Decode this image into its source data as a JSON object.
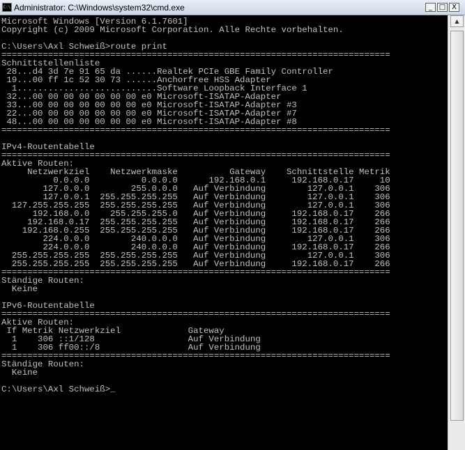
{
  "window": {
    "icon_text": "C:\\",
    "title": "Administrator: C:\\Windows\\system32\\cmd.exe",
    "minimize_glyph": "_",
    "maximize_glyph": "□",
    "close_glyph": "X"
  },
  "console": {
    "text": "Microsoft Windows [Version 6.1.7601]\nCopyright (c) 2009 Microsoft Corporation. Alle Rechte vorbehalten.\n\nC:\\Users\\Axl Schweiß>route print\n===========================================================================\nSchnittstellenliste\n 28...d4 3d 7e 91 65 da ......Realtek PCIe GBE Family Controller\n 19...00 ff 1c 52 30 73 ......Anchorfree HSS Adapter\n  1...........................Software Loopback Interface 1\n 32...00 00 00 00 00 00 00 e0 Microsoft-ISATAP-Adapter\n 33...00 00 00 00 00 00 00 e0 Microsoft-ISATAP-Adapter #3\n 22...00 00 00 00 00 00 00 e0 Microsoft-ISATAP-Adapter #7\n 48...00 00 00 00 00 00 00 e0 Microsoft-ISATAP-Adapter #8\n===========================================================================\n\nIPv4-Routentabelle\n===========================================================================\nAktive Routen:\n     Netzwerkziel    Netzwerkmaske          Gateway    Schnittstelle Metrik\n          0.0.0.0          0.0.0.0      192.168.0.1     192.168.0.17     10\n        127.0.0.0        255.0.0.0   Auf Verbindung        127.0.0.1    306\n        127.0.0.1  255.255.255.255   Auf Verbindung        127.0.0.1    306\n  127.255.255.255  255.255.255.255   Auf Verbindung        127.0.0.1    306\n      192.168.0.0    255.255.255.0   Auf Verbindung     192.168.0.17    266\n     192.168.0.17  255.255.255.255   Auf Verbindung     192.168.0.17    266\n    192.168.0.255  255.255.255.255   Auf Verbindung     192.168.0.17    266\n        224.0.0.0        240.0.0.0   Auf Verbindung        127.0.0.1    306\n        224.0.0.0        240.0.0.0   Auf Verbindung     192.168.0.17    266\n  255.255.255.255  255.255.255.255   Auf Verbindung        127.0.0.1    306\n  255.255.255.255  255.255.255.255   Auf Verbindung     192.168.0.17    266\n===========================================================================\nStändige Routen:\n  Keine\n\nIPv6-Routentabelle\n===========================================================================\nAktive Routen:\n If Metrik Netzwerkziel             Gateway\n  1    306 ::1/128                  Auf Verbindung\n  1    306 ff00::/8                 Auf Verbindung\n===========================================================================\nStändige Routen:\n  Keine\n\n",
    "prompt": "C:\\Users\\Axl Schweiß>",
    "cursor": "_"
  },
  "scrollbar": {
    "up_glyph": "▲"
  }
}
